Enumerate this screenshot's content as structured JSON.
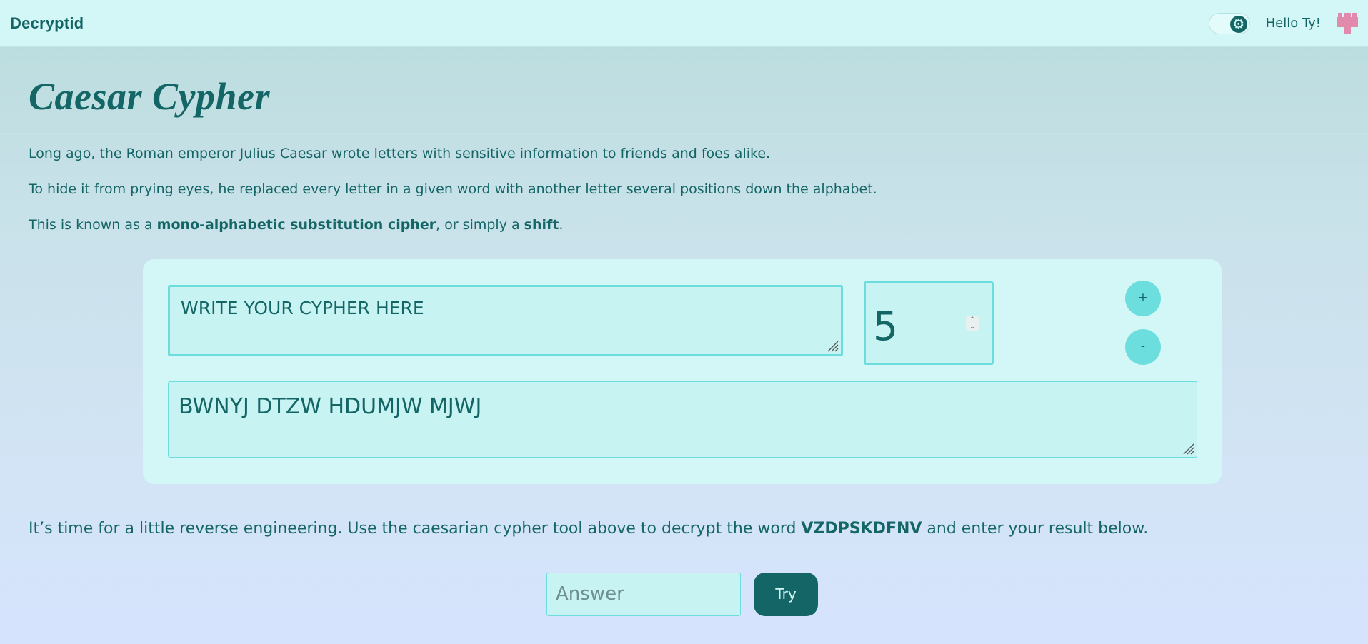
{
  "nav": {
    "brand": "Decryptid",
    "toggle_icon": "gear-icon",
    "greeting": "Hello Ty!",
    "avatar_icon": "pixel-avatar-icon",
    "avatar_color": "#e18aab"
  },
  "page": {
    "title": "Caesar Cypher",
    "para1": "Long ago, the Roman emperor Julius Caesar wrote letters with sensitive information to friends and foes alike.",
    "para2": "To hide it from prying eyes, he replaced every letter in a given word with another letter several positions down the alphabet.",
    "para3": {
      "pre": "This is known as a ",
      "bold1": "mono-alphabetic substitution cipher",
      "mid": ", or simply a ",
      "bold2": "shift",
      "post": "."
    }
  },
  "tool": {
    "input_value": "WRITE YOUR CYPHER HERE",
    "shift_value": "5",
    "plus_label": "+",
    "minus_label": "-",
    "output_value": "BWNYJ DTZW HDUMJW MJWJ"
  },
  "challenge": {
    "pre": "It’s time for a little reverse engineering. Use the caesarian cypher tool above to decrypt the word ",
    "word": "VZDPSKDFNV",
    "post": " and enter your result below.",
    "answer_placeholder": "Answer",
    "try_label": "Try"
  },
  "colors": {
    "primary": "#146566",
    "accent": "#6ddcdc",
    "card": "#d3f6f6",
    "field": "#c7f3f2"
  }
}
